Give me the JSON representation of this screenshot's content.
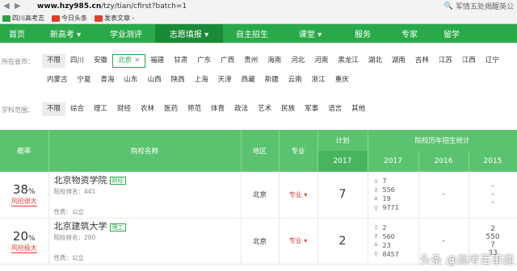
{
  "browser": {
    "url_host": "www.hzy985.cn",
    "url_path": "/tzy/tian/cfirst?batch=1",
    "right_text": "军情五处揭醒英公",
    "bookmarks": [
      "四川高考志",
      "今日头条",
      "发表文章 -"
    ]
  },
  "nav": {
    "items": [
      "首页",
      "新高考 ▾",
      "学业测评",
      "志愿填报 ▾",
      "自主招生",
      "课堂 ▾",
      "服务",
      "专家",
      "留学"
    ],
    "active_index": 3
  },
  "filters": {
    "location_label": "所在省市：",
    "locations": [
      "不限",
      "四川",
      "安徽",
      "北京",
      "福建",
      "甘肃",
      "广东",
      "广西",
      "贵州",
      "海南",
      "河北",
      "河南",
      "黑龙江",
      "湖北",
      "湖南",
      "吉林",
      "江苏",
      "江西",
      "辽宁",
      "内蒙古",
      "宁夏",
      "青海",
      "山东",
      "山西",
      "陕西",
      "上海",
      "天津",
      "西藏",
      "新疆",
      "云南",
      "浙江",
      "重庆"
    ],
    "location_selected": "北京",
    "discipline_label": "学科范围：",
    "disciplines": [
      "不限",
      "综合",
      "理工",
      "财经",
      "农林",
      "医药",
      "师范",
      "体育",
      "政法",
      "艺术",
      "民族",
      "军事",
      "语言",
      "其他"
    ]
  },
  "table": {
    "headers": {
      "rate": "概率",
      "school": "院校名称",
      "region": "地区",
      "major": "专业",
      "plan": "计划",
      "history": "院校历年招生统计",
      "plan_year": "2017",
      "years": [
        "2017",
        "2016",
        "2015"
      ]
    },
    "rows": [
      {
        "rate": "38",
        "rate_unit": "%",
        "risk": "风险很大",
        "name": "北京物资学院",
        "badge": "财经",
        "rank": "院校排名：441",
        "nature": "性质：公立",
        "region": "北京",
        "major": "专业 ▾",
        "plan": "7",
        "stats_2017": [
          "7",
          "556",
          "19",
          "9771"
        ],
        "col_2016": "-",
        "col_2015": [
          "-",
          "-",
          "-"
        ]
      },
      {
        "rate": "20",
        "rate_unit": "%",
        "risk": "风险极大",
        "name": "北京建筑大学",
        "badge": "理工",
        "rank": "院校排名：280",
        "nature": "性质：公立",
        "region": "北京",
        "major": "专业 ▾",
        "plan": "2",
        "stats_2017": [
          "2",
          "560",
          "23",
          "8457"
        ],
        "col_2016": "-",
        "col_2015": [
          "2",
          "550",
          "7",
          "33"
        ]
      }
    ]
  },
  "watermark": "头条 @高考百事通"
}
